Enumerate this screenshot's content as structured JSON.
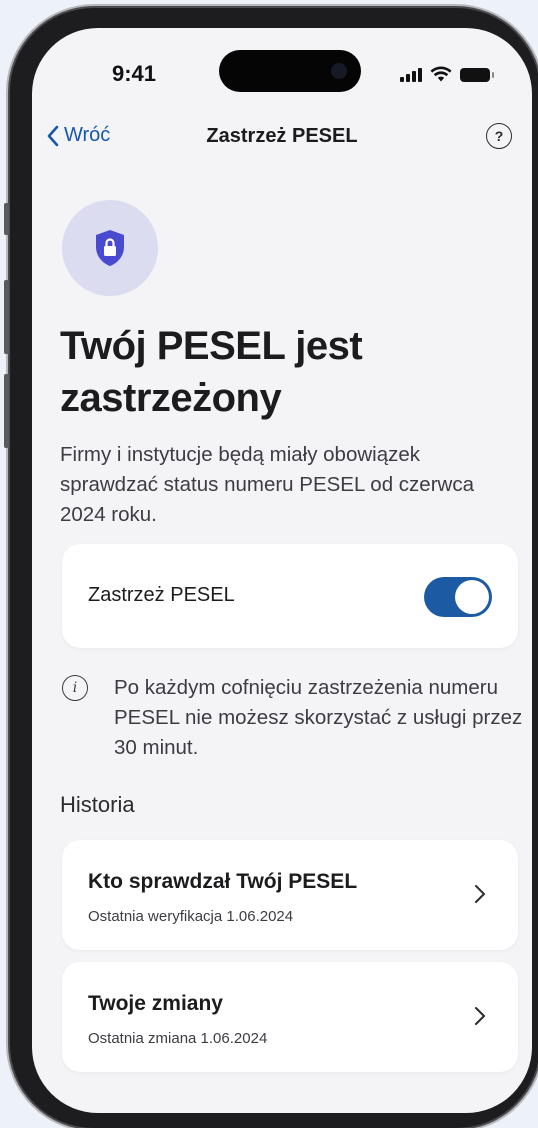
{
  "status": {
    "time": "9:41"
  },
  "nav": {
    "back_label": "Wróć",
    "title": "Zastrzeż PESEL",
    "help_symbol": "?"
  },
  "hero": {
    "headline": "Twój PESEL jest zastrzeżony",
    "description": "Firmy i instytucje będą miały obowiązek sprawdzać status numeru PESEL od czerwca 2024 roku.",
    "icon": "shield-lock-icon",
    "icon_bg": "#dcdcf0",
    "icon_color": "#4a4ad0"
  },
  "toggle": {
    "label": "Zastrzeż PESEL",
    "on": true,
    "color": "#1c5ba4"
  },
  "info": {
    "icon_symbol": "i",
    "text": "Po każdym cofnięciu zastrzeżenia numeru PESEL nie możesz skorzystać z usługi przez 30 minut."
  },
  "history": {
    "title": "Historia",
    "items": [
      {
        "title": "Kto sprawdzał Twój PESEL",
        "subtitle": "Ostatnia weryfikacja 1.06.2024"
      },
      {
        "title": "Twoje zmiany",
        "subtitle": "Ostatnia zmiana 1.06.2024"
      }
    ]
  },
  "colors": {
    "accent": "#1558b0",
    "background": "#f4f4f7",
    "card": "#ffffff"
  }
}
